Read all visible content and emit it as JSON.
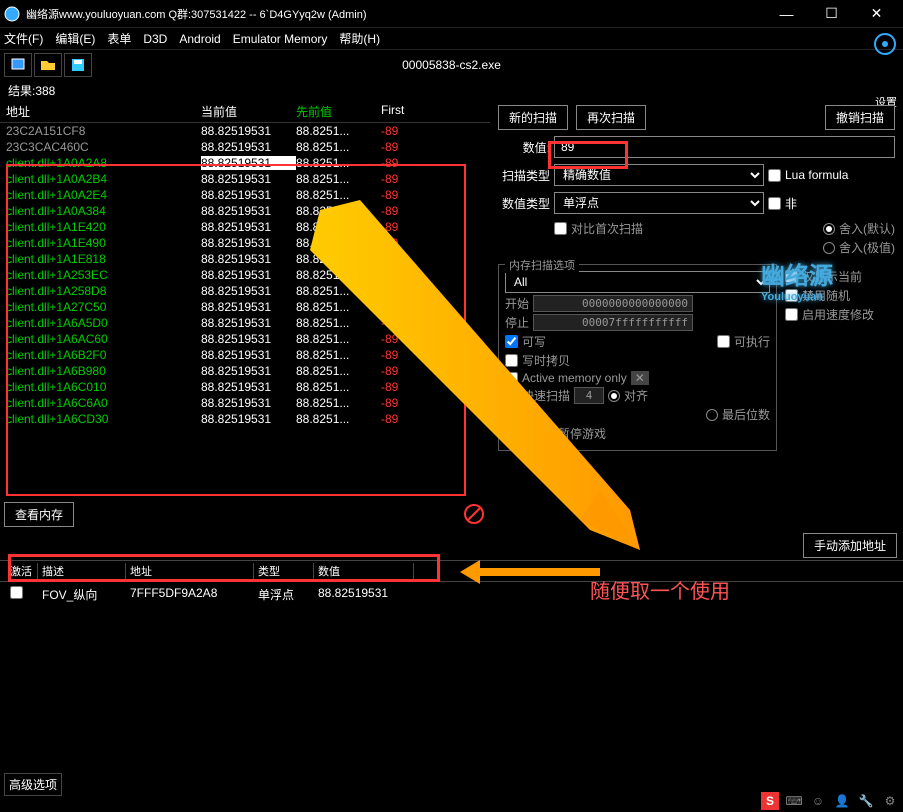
{
  "title": "幽络源www.youluoyuan.com Q群:307531422  --  6`D4GYyq2w (Admin)",
  "menu": {
    "file": "文件(F)",
    "edit": "编辑(E)",
    "form": "表单",
    "d3d": "D3D",
    "android": "Android",
    "emu": "Emulator Memory",
    "help": "帮助(H)"
  },
  "process": "00005838-cs2.exe",
  "settings": "设置",
  "results_label": "结果:388",
  "columns": {
    "addr": "地址",
    "cur": "当前值",
    "prev": "先前值",
    "first": "First"
  },
  "rows": [
    {
      "addr": "23C2A151CF8",
      "cur": "88.82519531",
      "prev": "88.8251...",
      "first": "-89",
      "cls": "gray"
    },
    {
      "addr": "23C3CAC460C",
      "cur": "88.82519531",
      "prev": "88.8251...",
      "first": "-89",
      "cls": "gray"
    },
    {
      "addr": "client.dll+1A0A2A8",
      "cur": "88.82519531",
      "prev": "88.8251...",
      "first": "-89",
      "cls": "green",
      "hl": true
    },
    {
      "addr": "client.dll+1A0A2B4",
      "cur": "88.82519531",
      "prev": "88.8251...",
      "first": "-89",
      "cls": "green"
    },
    {
      "addr": "client.dll+1A0A2E4",
      "cur": "88.82519531",
      "prev": "88.8251...",
      "first": "-89",
      "cls": "green"
    },
    {
      "addr": "client.dll+1A0A384",
      "cur": "88.82519531",
      "prev": "88.8251...",
      "first": "-89",
      "cls": "green"
    },
    {
      "addr": "client.dll+1A1E420",
      "cur": "88.82519531",
      "prev": "88.8251...",
      "first": "-89",
      "cls": "green"
    },
    {
      "addr": "client.dll+1A1E490",
      "cur": "88.82519531",
      "prev": "88.8251...",
      "first": "-89",
      "cls": "green"
    },
    {
      "addr": "client.dll+1A1E818",
      "cur": "88.82519531",
      "prev": "88.8251...",
      "first": "-89",
      "cls": "green"
    },
    {
      "addr": "client.dll+1A253EC",
      "cur": "88.82519531",
      "prev": "88.8251...",
      "first": "-89",
      "cls": "green"
    },
    {
      "addr": "client.dll+1A258D8",
      "cur": "88.82519531",
      "prev": "88.8251...",
      "first": "-89",
      "cls": "green"
    },
    {
      "addr": "client.dll+1A27C50",
      "cur": "88.82519531",
      "prev": "88.8251...",
      "first": "-89",
      "cls": "green"
    },
    {
      "addr": "client.dll+1A6A5D0",
      "cur": "88.82519531",
      "prev": "88.8251...",
      "first": "-89",
      "cls": "green"
    },
    {
      "addr": "client.dll+1A6AC60",
      "cur": "88.82519531",
      "prev": "88.8251...",
      "first": "-89",
      "cls": "green"
    },
    {
      "addr": "client.dll+1A6B2F0",
      "cur": "88.82519531",
      "prev": "88.8251...",
      "first": "-89",
      "cls": "green"
    },
    {
      "addr": "client.dll+1A6B980",
      "cur": "88.82519531",
      "prev": "88.8251...",
      "first": "-89",
      "cls": "green"
    },
    {
      "addr": "client.dll+1A6C010",
      "cur": "88.82519531",
      "prev": "88.8251...",
      "first": "-89",
      "cls": "green"
    },
    {
      "addr": "client.dll+1A6C6A0",
      "cur": "88.82519531",
      "prev": "88.8251...",
      "first": "-89",
      "cls": "green"
    },
    {
      "addr": "client.dll+1A6CD30",
      "cur": "88.82519531",
      "prev": "88.8251...",
      "first": "-89",
      "cls": "green"
    }
  ],
  "view_mem": "查看内存",
  "scan": {
    "new": "新的扫描",
    "next": "再次扫描",
    "undo": "撤销扫描",
    "value_label": "数值:",
    "value": "89",
    "type_label": "扫描类型",
    "type": "精确数值",
    "vtype_label": "数值类型",
    "vtype": "单浮点",
    "lua": "Lua formula",
    "not": "非",
    "round_def": "舍入(默认)",
    "round_ext": "舍入(极值)"
  },
  "memopt": {
    "title": "内存扫描选项",
    "all": "All",
    "start_l": "开始",
    "start": "0000000000000000",
    "stop_l": "停止",
    "stop": "00007fffffffffff",
    "compare": "对比首次扫描",
    "writable": "可写",
    "exec": "可执行",
    "cow": "写时拷贝",
    "amo": "Active memory only",
    "fast": "快速扫描",
    "fastv": "4",
    "align": "对齐",
    "lastbit": "最后位数",
    "pause": "扫描时暂停游戏",
    "norand": "禁用随机",
    "speed": "启用速度修改",
    "show": "仅显示当前"
  },
  "manual_add": "手动添加地址",
  "bot_cols": {
    "active": "激活",
    "desc": "描述",
    "addr": "地址",
    "type": "类型",
    "value": "数值"
  },
  "bot_row": {
    "desc": "FOV_纵向",
    "addr": "7FFF5DF9A2A8",
    "type": "单浮点",
    "value": "88.82519531"
  },
  "annotation": "随便取一个使用",
  "adv": "高级选项",
  "logo": "幽络源",
  "logo_sub": "Youluoyuan"
}
